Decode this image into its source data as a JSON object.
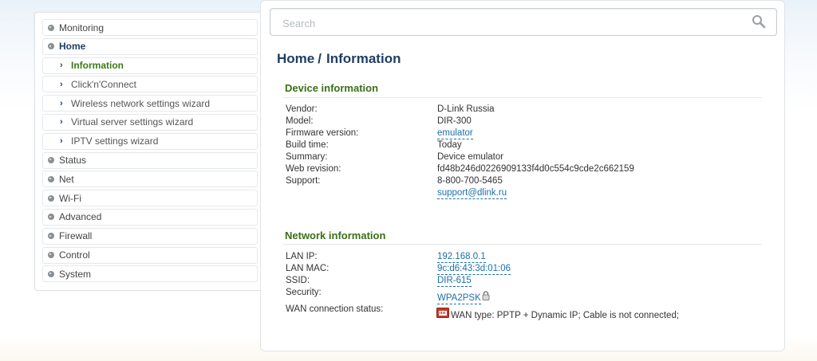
{
  "sidebar": {
    "items": [
      {
        "label": "Monitoring"
      },
      {
        "label": "Home"
      },
      {
        "label": "Information"
      },
      {
        "label": "Click'n'Connect"
      },
      {
        "label": "Wireless network settings wizard"
      },
      {
        "label": "Virtual server settings wizard"
      },
      {
        "label": "IPTV settings wizard"
      },
      {
        "label": "Status"
      },
      {
        "label": "Net"
      },
      {
        "label": "Wi-Fi"
      },
      {
        "label": "Advanced"
      },
      {
        "label": "Firewall"
      },
      {
        "label": "Control"
      },
      {
        "label": "System"
      }
    ]
  },
  "search": {
    "placeholder": "Search"
  },
  "breadcrumb": {
    "parent": "Home",
    "separator": "/",
    "current": "Information"
  },
  "device": {
    "title": "Device information",
    "vendor_label": "Vendor:",
    "vendor": "D-Link Russia",
    "model_label": "Model:",
    "model": "DIR-300",
    "firmware_label": "Firmware version:",
    "firmware": "emulator",
    "build_label": "Build time:",
    "build": "Today",
    "summary_label": "Summary:",
    "summary": "Device emulator",
    "webrev_label": "Web revision:",
    "webrev": "fd48b246d0226909133f4d0c554c9cde2c662159",
    "support_label": "Support:",
    "support_phone": "8-800-700-5465",
    "support_email": "support@dlink.ru"
  },
  "network": {
    "title": "Network information",
    "lanip_label": "LAN IP:",
    "lanip": "192.168.0.1",
    "lanmac_label": "LAN MAC:",
    "lanmac": "9c:d6:43:3d:01:06",
    "ssid_label": "SSID:",
    "ssid": "DIR-615",
    "security_label": "Security:",
    "security": "WPA2PSK",
    "wan_label": "WAN connection status:",
    "wan": "WAN type: PPTP + Dynamic IP; Cable is not connected;"
  },
  "colors": {
    "accent_blue": "#1f3e63",
    "section_green": "#3b6f17",
    "link_blue": "#1c6fa8",
    "wan_icon_red": "#c0392b"
  },
  "icons": {
    "search": "magnifier-icon",
    "security": "lock-icon",
    "wan": "ethernet-port-icon"
  }
}
